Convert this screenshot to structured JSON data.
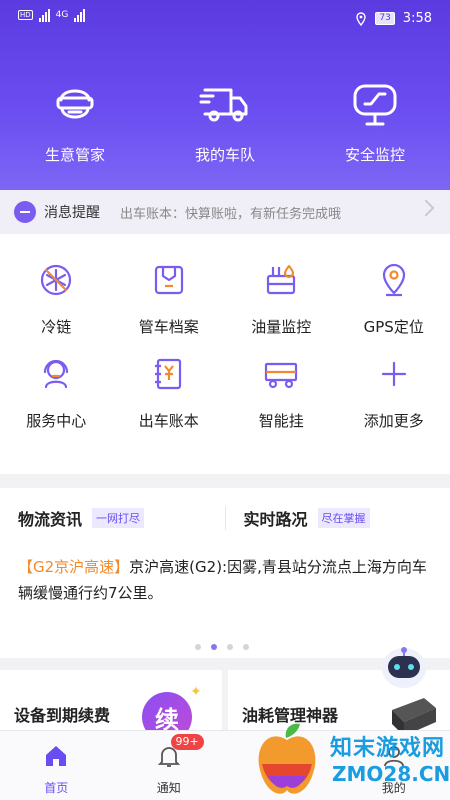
{
  "status_bar": {
    "network": "4G",
    "battery": "73",
    "time": "3:58"
  },
  "top_nav": [
    {
      "label": "生意管家",
      "icon": "steward-icon"
    },
    {
      "label": "我的车队",
      "icon": "truck-icon"
    },
    {
      "label": "安全监控",
      "icon": "monitor-icon"
    }
  ],
  "notice": {
    "title": "消息提醒",
    "text": "出车账本：快算账啦，有新任务完成哦"
  },
  "grid": [
    {
      "label": "冷链",
      "icon": "snowflake-icon"
    },
    {
      "label": "管车档案",
      "icon": "archive-icon"
    },
    {
      "label": "油量监控",
      "icon": "fuel-icon"
    },
    {
      "label": "GPS定位",
      "icon": "location-pin-icon"
    },
    {
      "label": "服务中心",
      "icon": "headset-icon"
    },
    {
      "label": "出车账本",
      "icon": "ledger-icon"
    },
    {
      "label": "智能挂",
      "icon": "trailer-icon"
    },
    {
      "label": "添加更多",
      "icon": "plus-icon"
    }
  ],
  "news": {
    "left": {
      "title": "物流资讯",
      "tag": "一网打尽"
    },
    "right": {
      "title": "实时路况",
      "tag": "尽在掌握"
    },
    "highlight": "【G2京沪高速】",
    "body": "京沪高速(G2):因雾,青县站分流点上海方向车辆缓慢通行约7公里。",
    "pages": 4,
    "active_page": 1
  },
  "promo": {
    "left": {
      "title": "设备到期续费",
      "badge": "续"
    },
    "right": {
      "title": "油耗管理神器"
    }
  },
  "tabbar": [
    {
      "label": "首页",
      "icon": "home-icon",
      "active": true
    },
    {
      "label": "通知",
      "icon": "bell-icon",
      "badge": "99+"
    },
    {
      "label": "",
      "icon": ""
    },
    {
      "label": "我的",
      "icon": "user-icon"
    }
  ],
  "watermark": {
    "cn": "知末游戏网",
    "en": "ZMO28.CN"
  },
  "colors": {
    "primary": "#6a4cf0",
    "highlight": "#f28a2b",
    "badge": "#f04444",
    "watermark": "#1a9de0"
  }
}
